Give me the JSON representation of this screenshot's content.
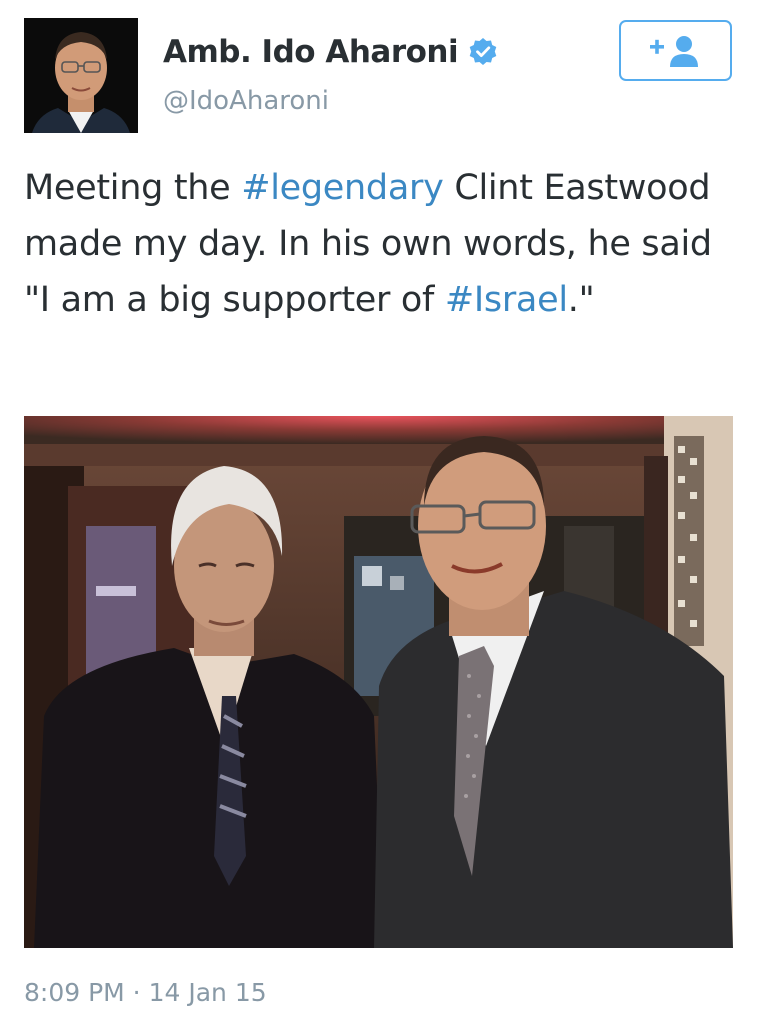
{
  "author": {
    "display_name": "Amb. Ido Aharoni",
    "handle": "@IdoAharoni",
    "verified": true,
    "avatar_icon": "profile-photo"
  },
  "follow_button": {
    "icon": "follow-user-icon",
    "color": "#55acee"
  },
  "tweet": {
    "text_parts": [
      {
        "type": "text",
        "value": "Meeting the "
      },
      {
        "type": "hashtag",
        "value": "#legendary"
      },
      {
        "type": "text",
        "value": " Clint Eastwood made my day. In his own words, he said \"I am a big supporter of "
      },
      {
        "type": "hashtag",
        "value": "#Israel"
      },
      {
        "type": "text",
        "value": ".\""
      }
    ],
    "photo_description_icon": "attached-photo"
  },
  "timestamp": "8:09 PM · 14 Jan 15",
  "colors": {
    "hashtag": "#3b88c3",
    "name": "#292f33",
    "secondary": "#8899a6",
    "verified": "#55acee"
  }
}
